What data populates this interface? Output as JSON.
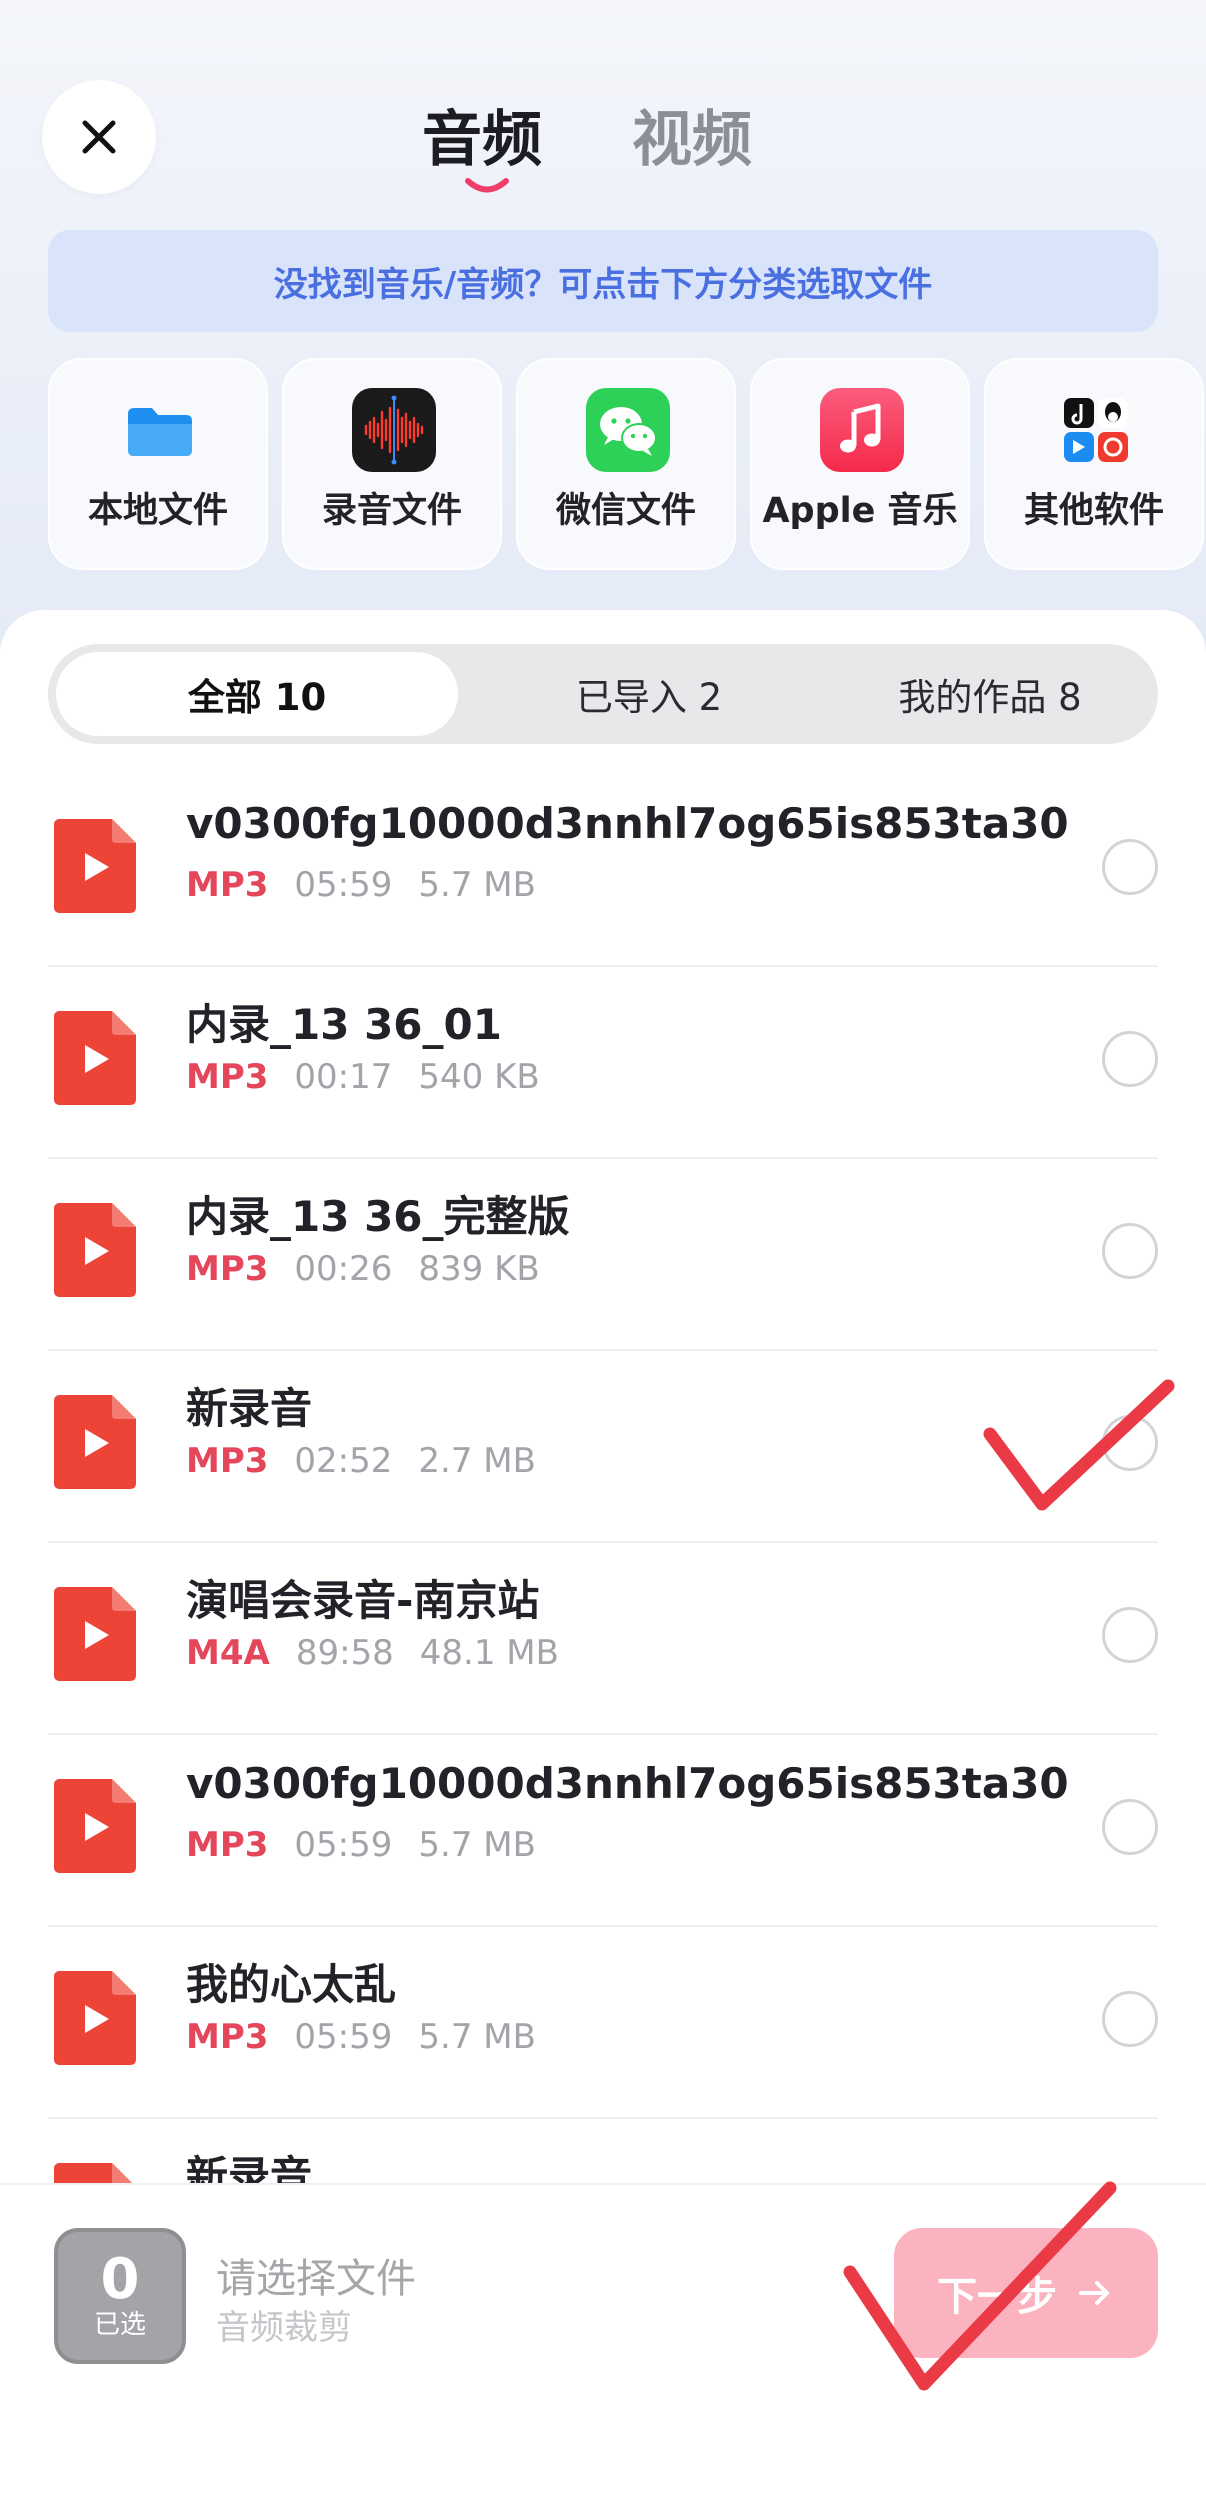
{
  "header": {
    "tabs": [
      {
        "label": "音频",
        "active": true
      },
      {
        "label": "视频",
        "active": false
      }
    ]
  },
  "hint": "没找到音乐/音频？可点击下方分类选取文件",
  "categories": [
    {
      "label": "本地文件",
      "icon": "folder-icon"
    },
    {
      "label": "录音文件",
      "icon": "voice-memo-icon"
    },
    {
      "label": "微信文件",
      "icon": "wechat-icon"
    },
    {
      "label": "Apple 音乐",
      "icon": "apple-music-icon"
    },
    {
      "label": "其他软件",
      "icon": "other-apps-icon"
    }
  ],
  "filters": [
    {
      "label": "全部 10",
      "active": true
    },
    {
      "label": "已导入 2",
      "active": false
    },
    {
      "label": "我的作品 8",
      "active": false
    }
  ],
  "files": [
    {
      "title": "v0300fg10000d3nnhl7og65is853ta30",
      "format": "MP3",
      "duration": "05:59",
      "size": "5.7 MB"
    },
    {
      "title": "内录_13 36_01",
      "format": "MP3",
      "duration": "00:17",
      "size": "540 KB"
    },
    {
      "title": "内录_13 36_完整版",
      "format": "MP3",
      "duration": "00:26",
      "size": "839 KB"
    },
    {
      "title": "新录音",
      "format": "MP3",
      "duration": "02:52",
      "size": "2.7 MB"
    },
    {
      "title": "演唱会录音-南京站",
      "format": "M4A",
      "duration": "89:58",
      "size": "48.1 MB"
    },
    {
      "title": "v0300fg10000d3nnhl7og65is853ta30",
      "format": "MP3",
      "duration": "05:59",
      "size": "5.7 MB"
    },
    {
      "title": "我的心太乱",
      "format": "MP3",
      "duration": "05:59",
      "size": "5.7 MB"
    },
    {
      "title": "新录音",
      "format": "",
      "duration": "",
      "size": ""
    }
  ],
  "bottom": {
    "count": "0",
    "count_label": "已选",
    "title": "请选择文件",
    "subtitle": "音频裁剪",
    "next_label": "下一步"
  },
  "colors": {
    "accent": "#e4465a",
    "hint_text": "#4a6fe0",
    "next_button": "#fbb3c0"
  }
}
